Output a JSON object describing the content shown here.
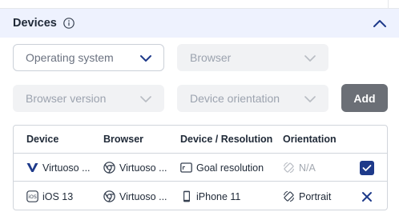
{
  "section": {
    "title": "Devices"
  },
  "filters": {
    "operating_system": "Operating system",
    "browser": "Browser",
    "browser_version": "Browser version",
    "device_orientation": "Device orientation",
    "add_label": "Add"
  },
  "colors": {
    "header_bg": "#eef2fe",
    "accent": "#1e3a8a",
    "add_button": "#6b6f76",
    "disabled_field": "#f1f2f4"
  },
  "table": {
    "columns": [
      "Device",
      "Browser",
      "Device / Resolution",
      "Orientation"
    ],
    "rows": [
      {
        "device": "Virtuoso ...",
        "device_icon": "virtuoso-logo-icon",
        "browser": "Virtuoso ...",
        "browser_icon": "chrome-icon",
        "resolution": "Goal resolution",
        "resolution_icon": "monitor-icon",
        "orientation": "N/A",
        "orientation_icon": "rotate-icon",
        "orientation_disabled": true,
        "action": "checkbox-checked"
      },
      {
        "device": "iOS 13",
        "device_icon": "ios-icon",
        "browser": "Virtuoso ...",
        "browser_icon": "chrome-icon",
        "resolution": "iPhone 11",
        "resolution_icon": "phone-icon",
        "orientation": "Portrait",
        "orientation_icon": "rotate-icon",
        "orientation_disabled": false,
        "action": "remove"
      }
    ]
  }
}
